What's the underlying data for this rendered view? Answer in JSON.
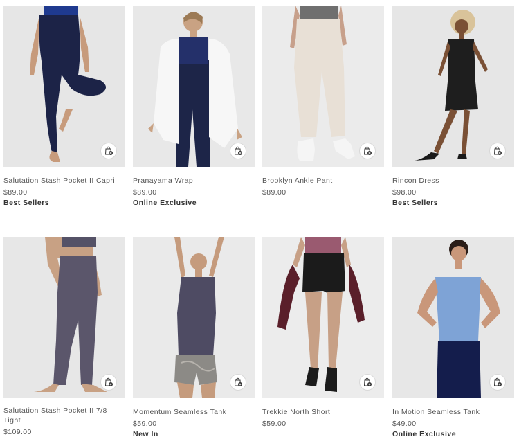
{
  "products": [
    {
      "name": "Salutation Stash Pocket II Capri",
      "price": "$89.00",
      "badge": "Best Sellers"
    },
    {
      "name": "Pranayama Wrap",
      "price": "$89.00",
      "badge": "Online Exclusive"
    },
    {
      "name": "Brooklyn Ankle Pant",
      "price": "$89.00",
      "badge": ""
    },
    {
      "name": "Rincon Dress",
      "price": "$98.00",
      "badge": "Best Sellers"
    },
    {
      "name": "Salutation Stash Pocket II 7/8 Tight",
      "price": "$109.00",
      "badge": ""
    },
    {
      "name": "Momentum Seamless Tank",
      "price": "$59.00",
      "badge": "New In"
    },
    {
      "name": "Trekkie North Short",
      "price": "$59.00",
      "badge": ""
    },
    {
      "name": "In Motion Seamless Tank",
      "price": "$49.00",
      "badge": "Online Exclusive"
    }
  ],
  "icons": {
    "add_to_bag": "shopping-bag-plus-icon"
  },
  "colors": {
    "photo_background": "#e9e9e9",
    "badge_text": "#333333",
    "body_text": "#555555"
  }
}
